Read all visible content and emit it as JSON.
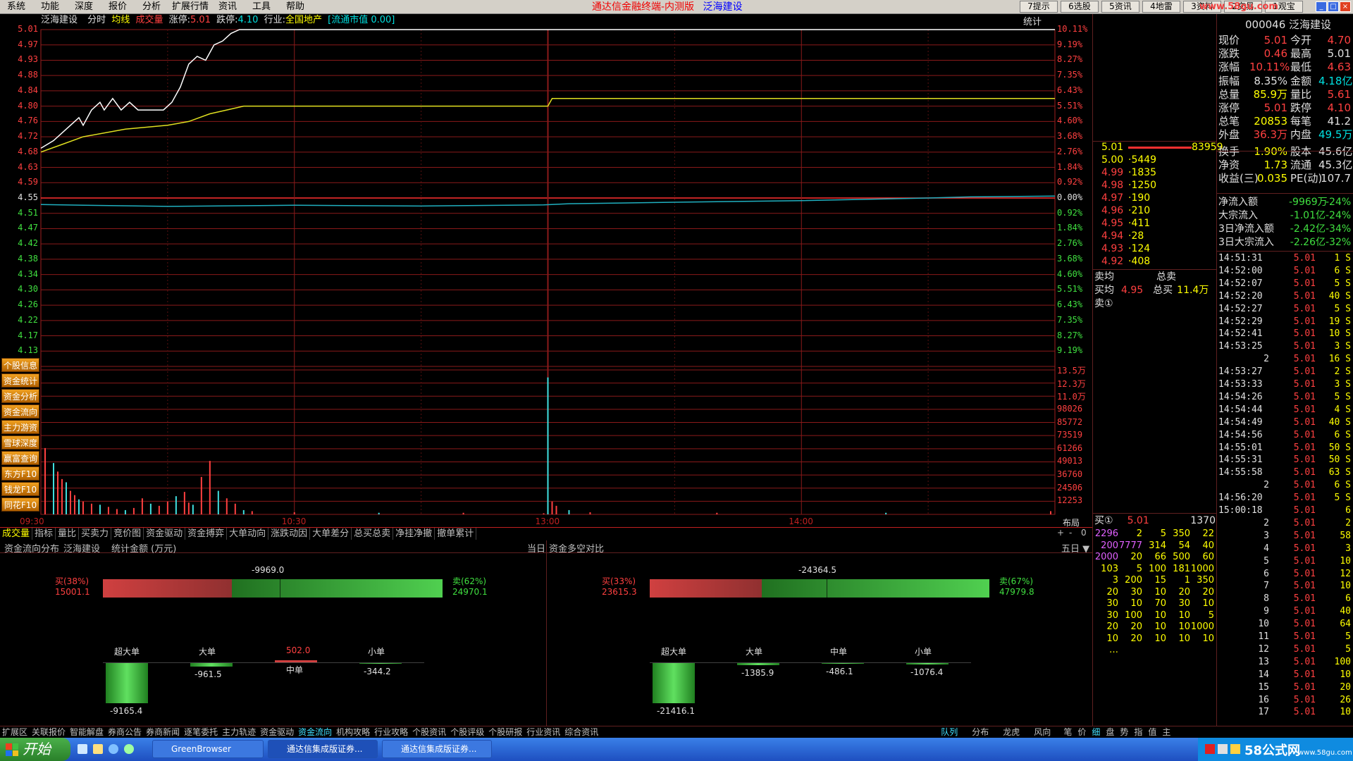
{
  "menu": [
    "系统",
    "功能",
    "深度",
    "报价",
    "分析",
    "扩展行情",
    "资讯",
    "工具",
    "帮助"
  ],
  "app_title": "通达信金融终端-内测版",
  "stock_title": "泛海建设",
  "top_buttons": [
    "7提示",
    "6选股",
    "5资讯",
    "4地雷",
    "3资料",
    "2交易",
    "1观宝"
  ],
  "watermark": "www.58gu.com",
  "info": {
    "name": "泛海建设",
    "mode": "分时",
    "avg_label": "均线",
    "vol_label": "成交量",
    "limit_up_label": "涨停:",
    "limit_up": "5.01",
    "limit_down_label": "跌停:",
    "limit_down": "4.10",
    "industry_label": "行业:",
    "industry": "全国地产",
    "circ_label": "[流通市值 0.00]",
    "stats_label": "统计"
  },
  "price_axis": [
    "5.01",
    "4.97",
    "4.93",
    "4.88",
    "4.84",
    "4.80",
    "4.76",
    "4.72",
    "4.68",
    "4.63",
    "4.59",
    "4.55",
    "4.51",
    "4.47",
    "4.42",
    "4.38",
    "4.34",
    "4.30",
    "4.26",
    "4.22",
    "4.17",
    "4.13"
  ],
  "pct_axis": [
    "10.11%",
    "9.19%",
    "8.27%",
    "7.35%",
    "6.43%",
    "5.51%",
    "4.60%",
    "3.68%",
    "2.76%",
    "1.84%",
    "0.92%",
    "0.00%",
    "0.92%",
    "1.84%",
    "2.76%",
    "3.68%",
    "4.60%",
    "5.51%",
    "6.43%",
    "7.35%",
    "8.27%",
    "9.19%"
  ],
  "vol_axis": [
    "13.5万",
    "12.3万",
    "11.0万",
    "98026",
    "85772",
    "73519",
    "61266",
    "49013",
    "36760",
    "24506",
    "12253"
  ],
  "time_axis": [
    "09:30",
    "10:30",
    "13:00",
    "14:00"
  ],
  "layout_label": "布局",
  "side_buttons": [
    "个股信息",
    "资金统计",
    "资金分析",
    "资金流向",
    "主力游资",
    "雪球深度",
    "赢富查询",
    "东方F10",
    "钱龙F10",
    "同花F10"
  ],
  "tabs": [
    "成交量",
    "指标",
    "量比",
    "买卖力",
    "竞价图",
    "资金驱动",
    "资金搏弈",
    "大单动向",
    "涨跌动因",
    "大单差分",
    "总买总卖",
    "净挂净撤",
    "撤单累计"
  ],
  "tab_ctrls": [
    "+",
    "-",
    "0"
  ],
  "panel_header": {
    "left_title": "资金流向分布",
    "left_stock": "泛海建设",
    "left_unit": "统计金额 (万元)",
    "left_period": "当日",
    "right_title": "资金多空对比",
    "right_period": "五日 ▼"
  },
  "left_panel": {
    "net": "-9969.0",
    "buy_label": "买(38%)",
    "buy_val": "15001.1",
    "sell_label": "卖(62%)",
    "sell_val": "24970.1",
    "buy_pct": 38,
    "cats": [
      {
        "name": "超大单",
        "val": "-9165.4"
      },
      {
        "name": "大单",
        "val": "-961.5"
      },
      {
        "name": "中单",
        "val": "502.0"
      },
      {
        "name": "小单",
        "val": "-344.2"
      }
    ]
  },
  "right_panel": {
    "net": "-24364.5",
    "buy_label": "买(33%)",
    "buy_val": "23615.3",
    "sell_label": "卖(67%)",
    "sell_val": "47979.8",
    "buy_pct": 33,
    "cats": [
      {
        "name": "超大单",
        "val": "-21416.1"
      },
      {
        "name": "大单",
        "val": "-1385.9"
      },
      {
        "name": "中单",
        "val": "-486.1"
      },
      {
        "name": "小单",
        "val": "-1076.4"
      }
    ]
  },
  "orderbook": {
    "bids": [
      {
        "p": "5.01",
        "v": "83959"
      },
      {
        "p": "5.00",
        "v": "5449"
      },
      {
        "p": "4.99",
        "v": "1835"
      },
      {
        "p": "4.98",
        "v": "1250"
      },
      {
        "p": "4.97",
        "v": "190"
      },
      {
        "p": "4.96",
        "v": "210"
      },
      {
        "p": "4.95",
        "v": "411"
      },
      {
        "p": "4.94",
        "v": "28"
      },
      {
        "p": "4.93",
        "v": "124"
      },
      {
        "p": "4.92",
        "v": "408"
      }
    ],
    "sell_avg_label": "卖均",
    "total_sell_label": "总卖",
    "buy_avg_label": "买均",
    "buy_avg": "4.95",
    "total_buy_label": "总买",
    "total_buy": "11.4万",
    "sell1_label": "卖①",
    "buy1_label": "买①",
    "buy1_price": "5.01",
    "buy1_vol": "1370",
    "queue": [
      [
        "2296",
        "2",
        "5",
        "350",
        "22"
      ],
      [
        "200",
        "7777",
        "314",
        "54",
        "40"
      ],
      [
        "2000",
        "20",
        "66",
        "500",
        "60"
      ],
      [
        "103",
        "5",
        "100",
        "181",
        "1000"
      ],
      [
        "3",
        "200",
        "15",
        "1",
        "350"
      ],
      [
        "20",
        "30",
        "10",
        "20",
        "20"
      ],
      [
        "30",
        "10",
        "70",
        "30",
        "10"
      ],
      [
        "30",
        "100",
        "10",
        "10",
        "5"
      ],
      [
        "20",
        "20",
        "10",
        "10",
        "1000"
      ],
      [
        "10",
        "20",
        "10",
        "10",
        "10"
      ],
      [
        "…",
        "",
        "",
        "",
        ""
      ]
    ]
  },
  "stats": {
    "code": "000046 泛海建设",
    "rows": [
      [
        "现价",
        "5.01",
        "今开",
        "4.70"
      ],
      [
        "涨跌",
        "0.46",
        "最高",
        "5.01"
      ],
      [
        "涨幅",
        "10.11%",
        "最低",
        "4.63"
      ],
      [
        "振幅",
        "8.35%",
        "金额",
        "4.18亿"
      ],
      [
        "总量",
        "85.9万",
        "量比",
        "5.61"
      ],
      [
        "涨停",
        "5.01",
        "跌停",
        "4.10"
      ],
      [
        "总笔",
        "20853",
        "每笔",
        "41.2"
      ],
      [
        "外盘",
        "36.3万",
        "内盘",
        "49.5万"
      ],
      [
        "换手",
        "1.90%",
        "股本",
        "45.6亿"
      ],
      [
        "净资",
        "1.73",
        "流通",
        "45.3亿"
      ],
      [
        "收益(三)",
        "0.035",
        "PE(动)",
        "107.7"
      ]
    ],
    "flows": [
      [
        "净流入额",
        "-9969万",
        "-24%"
      ],
      [
        "大宗流入",
        "-1.01亿",
        "-24%"
      ],
      [
        "3日净流入额",
        "-2.42亿",
        "-34%"
      ],
      [
        "3日大宗流入",
        "-2.26亿",
        "-32%"
      ]
    ],
    "ticks": [
      [
        "14:51:31",
        "5.01",
        "1 S"
      ],
      [
        "14:52:00",
        "5.01",
        "6 S"
      ],
      [
        "14:52:07",
        "5.01",
        "5 S"
      ],
      [
        "14:52:20",
        "5.01",
        "40 S"
      ],
      [
        "14:52:27",
        "5.01",
        "5 S"
      ],
      [
        "14:52:29",
        "5.01",
        "19 S"
      ],
      [
        "14:52:41",
        "5.01",
        "10 S"
      ],
      [
        "14:53:25",
        "5.01",
        "3 S"
      ],
      [
        "2",
        "5.01",
        "16 S"
      ],
      [
        "14:53:27",
        "5.01",
        "2 S"
      ],
      [
        "14:53:33",
        "5.01",
        "3 S"
      ],
      [
        "14:54:26",
        "5.01",
        "5 S"
      ],
      [
        "14:54:44",
        "5.01",
        "4 S"
      ],
      [
        "14:54:49",
        "5.01",
        "40 S"
      ],
      [
        "14:54:56",
        "5.01",
        "6 S"
      ],
      [
        "14:55:01",
        "5.01",
        "50 S"
      ],
      [
        "14:55:31",
        "5.01",
        "50 S"
      ],
      [
        "14:55:58",
        "5.01",
        "63 S"
      ],
      [
        "2",
        "5.01",
        "6 S"
      ],
      [
        "14:56:20",
        "5.01",
        "5 S"
      ],
      [
        "15:00:18",
        "5.01",
        "6"
      ],
      [
        "2",
        "5.01",
        "2"
      ],
      [
        "3",
        "5.01",
        "58"
      ],
      [
        "4",
        "5.01",
        "3"
      ],
      [
        "5",
        "5.01",
        "10"
      ],
      [
        "6",
        "5.01",
        "12"
      ],
      [
        "7",
        "5.01",
        "10"
      ],
      [
        "8",
        "5.01",
        "6"
      ],
      [
        "9",
        "5.01",
        "40"
      ],
      [
        "10",
        "5.01",
        "64"
      ],
      [
        "11",
        "5.01",
        "5"
      ],
      [
        "12",
        "5.01",
        "5"
      ],
      [
        "13",
        "5.01",
        "100"
      ],
      [
        "14",
        "5.01",
        "10"
      ],
      [
        "15",
        "5.01",
        "20"
      ],
      [
        "16",
        "5.01",
        "26"
      ],
      [
        "17",
        "5.01",
        "10"
      ]
    ]
  },
  "right_tabs_a": [
    "队列",
    "分布",
    "龙虎",
    "风向"
  ],
  "right_tabs_b": [
    "笔",
    "价",
    "细",
    "盘",
    "势",
    "指",
    "值",
    "主"
  ],
  "bottom_tabs": [
    "扩展区",
    "关联报价",
    "智能解盘",
    "券商公告",
    "券商新闻",
    "逐笔委托",
    "主力轨迹",
    "资金驱动",
    "资金流向",
    "机构攻略",
    "行业攻略",
    "个股资讯",
    "个股评级",
    "个股研报",
    "行业资讯",
    "综合资讯"
  ],
  "taskbar": {
    "start": "开始",
    "tasks": [
      "GreenBrowser",
      "通达信集成版证券...",
      "通达信集成版证券..."
    ],
    "tray_brand": "58公式网",
    "tray_url": "www.58gu.com"
  },
  "chart_data": {
    "type": "line",
    "price_range": [
      4.13,
      5.01
    ],
    "prev_close": 4.55,
    "price_series": [
      [
        0,
        4.7
      ],
      [
        3,
        4.72
      ],
      [
        5,
        4.74
      ],
      [
        7,
        4.76
      ],
      [
        9,
        4.78
      ],
      [
        10,
        4.76
      ],
      [
        12,
        4.8
      ],
      [
        14,
        4.82
      ],
      [
        15,
        4.8
      ],
      [
        17,
        4.83
      ],
      [
        19,
        4.8
      ],
      [
        21,
        4.82
      ],
      [
        23,
        4.8
      ],
      [
        25,
        4.8
      ],
      [
        27,
        4.8
      ],
      [
        29,
        4.8
      ],
      [
        31,
        4.82
      ],
      [
        33,
        4.86
      ],
      [
        35,
        4.92
      ],
      [
        37,
        4.94
      ],
      [
        39,
        4.93
      ],
      [
        41,
        4.97
      ],
      [
        43,
        4.98
      ],
      [
        45,
        5.0
      ],
      [
        47,
        5.01
      ],
      [
        240,
        5.01
      ]
    ],
    "avg_series": [
      [
        0,
        4.69
      ],
      [
        5,
        4.71
      ],
      [
        10,
        4.73
      ],
      [
        20,
        4.75
      ],
      [
        30,
        4.76
      ],
      [
        35,
        4.77
      ],
      [
        40,
        4.79
      ],
      [
        44,
        4.8
      ],
      [
        48,
        4.81
      ],
      [
        60,
        4.81
      ],
      [
        120,
        4.81
      ],
      [
        121,
        4.83
      ],
      [
        150,
        4.83
      ],
      [
        200,
        4.83
      ],
      [
        240,
        4.83
      ]
    ],
    "index_series": [
      [
        0,
        4.553
      ],
      [
        10,
        4.551
      ],
      [
        30,
        4.548
      ],
      [
        60,
        4.551
      ],
      [
        90,
        4.549
      ],
      [
        119,
        4.552
      ],
      [
        125,
        4.555
      ],
      [
        150,
        4.559
      ],
      [
        180,
        4.563
      ],
      [
        210,
        4.57
      ],
      [
        220,
        4.573
      ],
      [
        240,
        4.575
      ]
    ],
    "volume_max": 135000,
    "volume_series": [
      [
        1,
        62000
      ],
      [
        3,
        48000
      ],
      [
        4,
        40000
      ],
      [
        5,
        33000
      ],
      [
        6,
        30000
      ],
      [
        7,
        22000
      ],
      [
        8,
        18000
      ],
      [
        9,
        14000
      ],
      [
        10,
        12000
      ],
      [
        12,
        10000
      ],
      [
        14,
        9000
      ],
      [
        16,
        7000
      ],
      [
        18,
        5000
      ],
      [
        20,
        4000
      ],
      [
        22,
        6000
      ],
      [
        24,
        15000
      ],
      [
        26,
        10000
      ],
      [
        28,
        8000
      ],
      [
        30,
        12000
      ],
      [
        32,
        17000
      ],
      [
        34,
        21000
      ],
      [
        35,
        11000
      ],
      [
        36,
        9000
      ],
      [
        38,
        35000
      ],
      [
        40,
        50000
      ],
      [
        42,
        22000
      ],
      [
        44,
        15000
      ],
      [
        46,
        10000
      ],
      [
        48,
        4000
      ],
      [
        50,
        3000
      ],
      [
        60,
        2000
      ],
      [
        80,
        1500
      ],
      [
        100,
        1500
      ],
      [
        119,
        1000
      ],
      [
        120,
        128000
      ],
      [
        121,
        12000
      ],
      [
        122,
        8000
      ],
      [
        125,
        4000
      ],
      [
        130,
        2000
      ],
      [
        160,
        1500
      ],
      [
        200,
        1500
      ],
      [
        239,
        3000
      ]
    ]
  }
}
